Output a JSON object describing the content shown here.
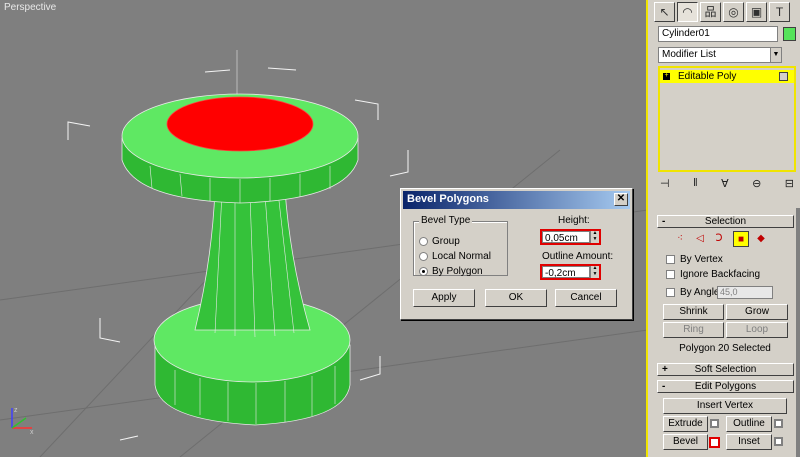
{
  "viewport": {
    "label": "Perspective"
  },
  "dialog": {
    "title": "Bevel Polygons",
    "close_glyph": "✕",
    "bevel_type_label": "Bevel Type",
    "options": [
      "Group",
      "Local Normal",
      "By Polygon"
    ],
    "selected_option": "By Polygon",
    "height_label": "Height:",
    "height_value": "0,05cm",
    "outline_label": "Outline Amount:",
    "outline_value": "-0,2cm",
    "apply_label": "Apply",
    "ok_label": "OK",
    "cancel_label": "Cancel"
  },
  "panel": {
    "tabs": [
      "create-icon",
      "modify-icon",
      "hierarchy-icon",
      "motion-icon",
      "display-icon",
      "utilities-icon"
    ],
    "object_name": "Cylinder01",
    "object_color": "#55e35a",
    "modifier_list_label": "Modifier List",
    "stack_item": "Editable Poly",
    "selection": {
      "header": "Selection",
      "by_vertex": "By Vertex",
      "ignore_backfacing": "Ignore Backfacing",
      "by_angle": "By Angle:",
      "angle_value": "45,0",
      "shrink": "Shrink",
      "grow": "Grow",
      "ring": "Ring",
      "loop": "Loop",
      "status": "Polygon 20 Selected"
    },
    "soft_selection": {
      "header": "Soft Selection",
      "sign": "+"
    },
    "edit_polygons": {
      "header": "Edit Polygons",
      "sign": "-",
      "insert_vertex": "Insert Vertex",
      "extrude": "Extrude",
      "outline": "Outline",
      "bevel": "Bevel",
      "inset": "Inset"
    },
    "selection_sign": "-"
  },
  "colors": {
    "object_green": "#55e35a",
    "selected_face": "#ff0000",
    "active_highlight": "#ffff00",
    "dialog_title": "#0a246a"
  }
}
